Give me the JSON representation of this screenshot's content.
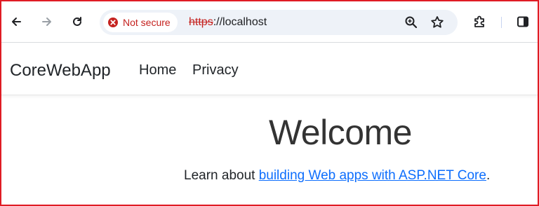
{
  "browser": {
    "security_label": "Not secure",
    "url_scheme": "https",
    "url_rest": "://localhost",
    "icons": [
      "back-arrow-icon",
      "forward-arrow-icon",
      "reload-icon",
      "not-secure-icon",
      "zoom-icon",
      "bookmark-star-icon",
      "extensions-icon",
      "side-panel-icon"
    ]
  },
  "navbar": {
    "brand": "CoreWebApp",
    "links": [
      "Home",
      "Privacy"
    ]
  },
  "main": {
    "title": "Welcome",
    "learn_prefix": "Learn about ",
    "learn_link": "building Web apps with ASP.NET Core",
    "learn_suffix": "."
  },
  "colors": {
    "frame_border": "#e01c24",
    "not_secure": "#c5221f",
    "link": "#0d6efd"
  }
}
